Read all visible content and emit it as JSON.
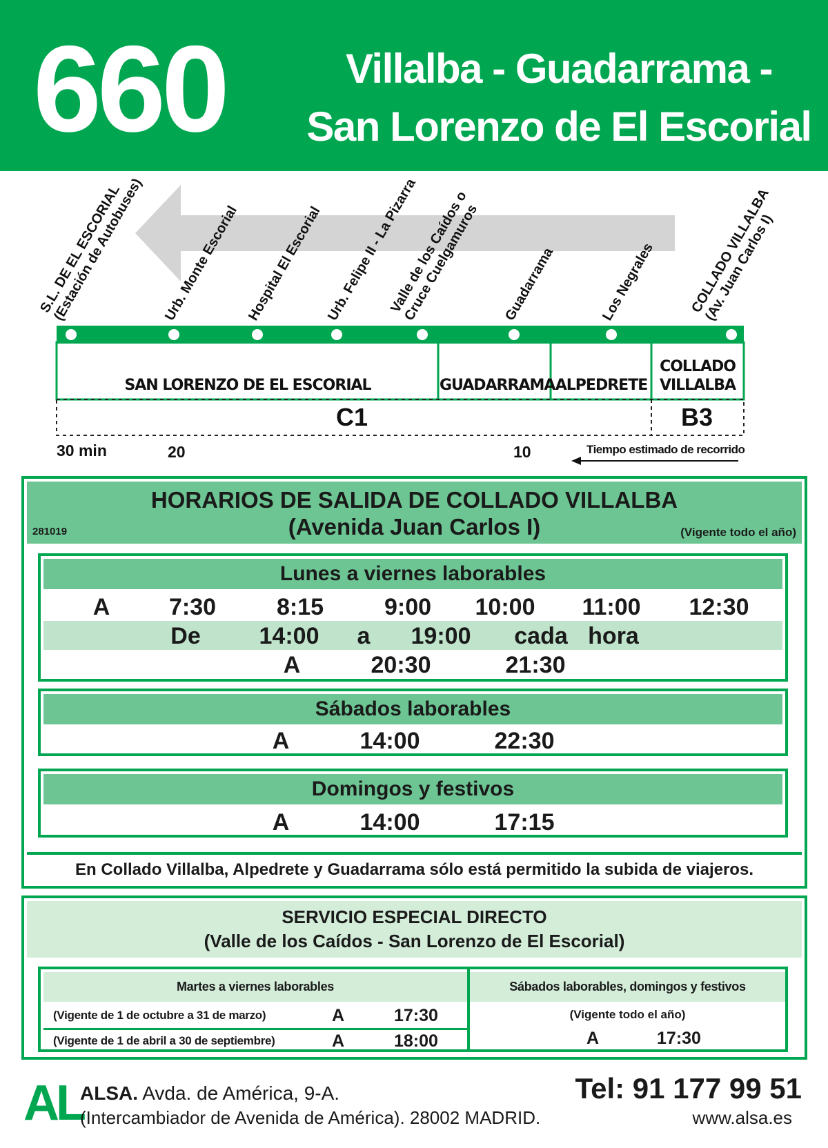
{
  "header": {
    "route_number": "660",
    "route_line1": "Villalba - Guadarrama -",
    "route_line2": "San Lorenzo de El Escorial"
  },
  "stops": [
    {
      "line1": "S.L. DE EL ESCORIAL",
      "line2": "(Estación de Autobuses)"
    },
    {
      "line1": "Urb. Monte Escorial",
      "line2": ""
    },
    {
      "line1": "Hospital El Escorial",
      "line2": ""
    },
    {
      "line1": "Urb. Felipe II - La Pizarra",
      "line2": ""
    },
    {
      "line1": "Valle de los Caídos o",
      "line2": "Cruce Cuelgamuros"
    },
    {
      "line1": "Guadarrama",
      "line2": ""
    },
    {
      "line1": "Los Negrales",
      "line2": ""
    },
    {
      "line1": "COLLADO VILLALBA",
      "line2": "(Av. Juan Carlos I)"
    }
  ],
  "zones": {
    "san_lorenzo": "SAN LORENZO DE EL ESCORIAL",
    "guadarrama": "GUADARRAMA",
    "alpedrete": "ALPEDRETE",
    "villalba_1": "COLLADO",
    "villalba_2": "VILLALBA",
    "fare_c1": "C1",
    "fare_b3": "B3"
  },
  "travel_times": {
    "t30": "30 min",
    "t20": "20",
    "t10": "10",
    "note": "Tiempo estimado de recorrido"
  },
  "schedule": {
    "title1": "HORARIOS DE SALIDA DE COLLADO VILLALBA",
    "title2": "(Avenida Juan Carlos I)",
    "code": "281019",
    "validity": "(Vigente todo el año)",
    "weekdays": {
      "heading": "Lunes a viernes laborables",
      "row1": [
        "A",
        "7:30",
        "8:15",
        "9:00",
        "10:00",
        "11:00",
        "12:30"
      ],
      "row2": [
        "De",
        "14:00",
        "a",
        "19:00",
        "cada",
        "hora"
      ],
      "row3": [
        "A",
        "20:30",
        "21:30"
      ]
    },
    "saturdays": {
      "heading": "Sábados laborables",
      "row1": [
        "A",
        "14:00",
        "22:30"
      ]
    },
    "sundays": {
      "heading": "Domingos y festivos",
      "row1": [
        "A",
        "14:00",
        "17:15"
      ]
    },
    "notice": "En Collado Villalba, Alpedrete y Guadarrama sólo está permitido la subida de viajeros."
  },
  "special": {
    "title1": "SERVICIO ESPECIAL DIRECTO",
    "title2": "(Valle de los Caídos - San Lorenzo de El Escorial)",
    "left_heading": "Martes a viernes laborables",
    "right_heading": "Sábados laborables, domingos y festivos",
    "left_rows": [
      {
        "validity": "(Vigente de 1 de octubre a 31 de marzo)",
        "label": "A",
        "time": "17:30"
      },
      {
        "validity": "(Vigente de 1 de abril a 30 de septiembre)",
        "label": "A",
        "time": "18:00"
      }
    ],
    "right_validity": "(Vigente todo el año)",
    "right_label": "A",
    "right_time": "17:30"
  },
  "footer": {
    "logo": "AL",
    "company": "ALSA.",
    "address1": " Avda. de América, 9-A.",
    "address2": "(Intercambiador de Avenida de América). 28002 MADRID.",
    "phone": "Tel: 91 177 99 51",
    "web": "www.alsa.es"
  },
  "colors": {
    "brand_green": "#00a650",
    "head_green": "#6cc592",
    "light_green": "#bfe4cb",
    "pale_green": "#d3edd9",
    "arrow_grey": "#d4d4d4"
  }
}
